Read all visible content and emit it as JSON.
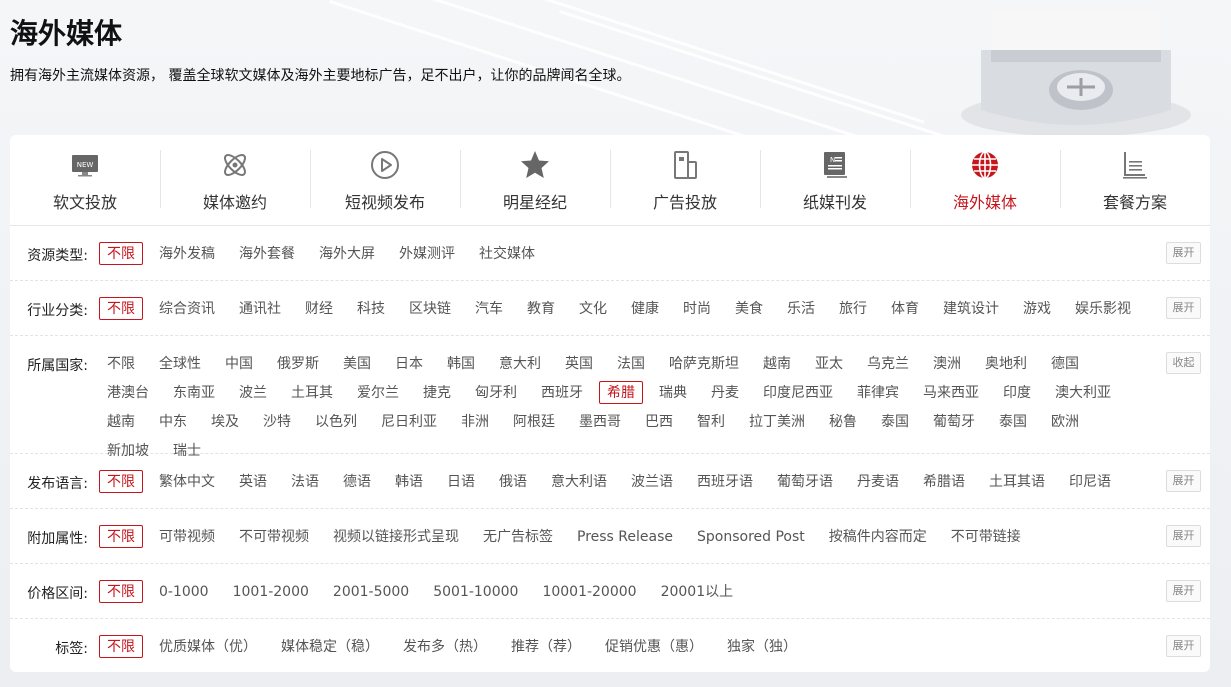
{
  "header": {
    "title": "海外媒体",
    "subtitle": "拥有海外主流媒体资源， 覆盖全球软文媒体及海外主要地标广告，足不出户，让你的品牌闻名全球。"
  },
  "colors": {
    "accent": "#c4161c",
    "text": "#333333",
    "muted": "#555555"
  },
  "tabs": [
    {
      "label": "软文投放",
      "icon": "news-icon"
    },
    {
      "label": "媒体邀约",
      "icon": "atom-icon"
    },
    {
      "label": "短视频发布",
      "icon": "play-icon"
    },
    {
      "label": "明星经纪",
      "icon": "star-icon"
    },
    {
      "label": "广告投放",
      "icon": "billboard-icon"
    },
    {
      "label": "纸媒刊发",
      "icon": "newspaper-icon"
    },
    {
      "label": "海外媒体",
      "icon": "globe-icon",
      "active": true
    },
    {
      "label": "套餐方案",
      "icon": "package-icon"
    }
  ],
  "filters": [
    {
      "label": "资源类型:",
      "toggle": "展开",
      "options": [
        "不限",
        "海外发稿",
        "海外套餐",
        "海外大屏",
        "外媒测评",
        "社交媒体"
      ],
      "selected": 0
    },
    {
      "label": "行业分类:",
      "toggle": "展开",
      "options": [
        "不限",
        "综合资讯",
        "通讯社",
        "财经",
        "科技",
        "区块链",
        "汽车",
        "教育",
        "文化",
        "健康",
        "时尚",
        "美食",
        "乐活",
        "旅行",
        "体育",
        "建筑设计",
        "游戏",
        "娱乐影视"
      ],
      "selected": 0
    },
    {
      "label": "所属国家:",
      "toggle": "收起",
      "options": [
        "不限",
        "全球性",
        "中国",
        "俄罗斯",
        "美国",
        "日本",
        "韩国",
        "意大利",
        "英国",
        "法国",
        "哈萨克斯坦",
        "越南",
        "亚太",
        "乌克兰",
        "澳洲",
        "奥地利",
        "德国",
        "港澳台",
        "东南亚",
        "波兰",
        "土耳其",
        "爱尔兰",
        "捷克",
        "匈牙利",
        "西班牙",
        "希腊",
        "瑞典",
        "丹麦",
        "印度尼西亚",
        "菲律宾",
        "马来西亚",
        "印度",
        "澳大利亚",
        "越南",
        "中东",
        "埃及",
        "沙特",
        "以色列",
        "尼日利亚",
        "非洲",
        "阿根廷",
        "墨西哥",
        "巴西",
        "智利",
        "拉丁美洲",
        "秘鲁",
        "泰国",
        "葡萄牙",
        "泰国",
        "欧洲",
        "新加坡",
        "瑞士"
      ],
      "selected": 25
    },
    {
      "label": "发布语言:",
      "toggle": "展开",
      "options": [
        "不限",
        "繁体中文",
        "英语",
        "法语",
        "德语",
        "韩语",
        "日语",
        "俄语",
        "意大利语",
        "波兰语",
        "西班牙语",
        "葡萄牙语",
        "丹麦语",
        "希腊语",
        "土耳其语",
        "印尼语"
      ],
      "selected": 0
    },
    {
      "label": "附加属性:",
      "toggle": "展开",
      "options": [
        "不限",
        "可带视频",
        "不可带视频",
        "视频以链接形式呈现",
        "无广告标签",
        "Press Release",
        "Sponsored Post",
        "按稿件内容而定",
        "不可带链接"
      ],
      "selected": 0
    },
    {
      "label": "价格区间:",
      "toggle": "展开",
      "options": [
        "不限",
        "0-1000",
        "1001-2000",
        "2001-5000",
        "5001-10000",
        "10001-20000",
        "20001以上"
      ],
      "selected": 0
    },
    {
      "label": "标签:",
      "toggle": "展开",
      "options": [
        "不限",
        "优质媒体（优）",
        "媒体稳定（稳）",
        "发布多（热）",
        "推荐（荐）",
        "促销优惠（惠）",
        "独家（独）"
      ],
      "selected": 0
    }
  ]
}
